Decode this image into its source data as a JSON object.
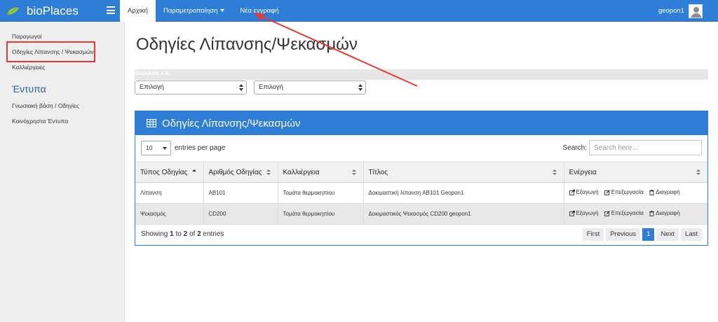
{
  "app": {
    "name": "bioPlaces"
  },
  "nav": {
    "tabs": [
      {
        "label": "Αρχική",
        "active": true
      },
      {
        "label": "Παραμετροποίηση",
        "dropdown": true
      },
      {
        "label": "Νέα εγγραφή"
      }
    ]
  },
  "user": {
    "name": "geopon1"
  },
  "sidebar": {
    "items": [
      {
        "label": "Παραγωγοί"
      },
      {
        "label": "Οδηγίες Λίπανσης / Ψεκασμών"
      },
      {
        "label": "Καλλιέργειες"
      }
    ],
    "section_title": "Έντυπα",
    "section_items": [
      {
        "label": "Γνωσιακή βάση / Οδηγίες"
      },
      {
        "label": "Κοινόχρηστα Έντυπα"
      }
    ]
  },
  "main": {
    "title": "Οδηγίες Λίπανσης/Ψεκασμών",
    "company_label": "DIANAME A.E.",
    "filters": [
      {
        "value": "Επιλογή"
      },
      {
        "value": "Επιλογή"
      }
    ],
    "panel": {
      "title": "Οδηγίες Λίπανσης/Ψεκασμών",
      "page_length": "10",
      "page_length_label": "entries per page",
      "search_label": "Search:",
      "search_placeholder": "Search here...",
      "columns": [
        "Τύπος Οδηγίας",
        "Αριθμός Οδηγίας",
        "Καλλιέργεια",
        "Τίτλος",
        "Ενέργεια"
      ],
      "rows": [
        {
          "type": "Λίπανση",
          "number": "AB101",
          "crop": "Τομάτα θερμοκηπίου",
          "title": "Δοκιμαστική λίπανση AB101 Geopon1"
        },
        {
          "type": "Ψεκασμός",
          "number": "CD200",
          "crop": "Τομάτα θερμοκηπίου",
          "title": "Δοκιμαστικός Ψεκασμός CD200 geopon1"
        }
      ],
      "actions": {
        "export": "Εξαγωγή",
        "edit": "Επεξεργασία",
        "delete": "Διαγραφή"
      },
      "info": {
        "prefix": "Showing",
        "from": "1",
        "to_word": "to",
        "to": "2",
        "of_word": "of",
        "total": "2",
        "suffix": "entries"
      },
      "pager": {
        "first": "First",
        "previous": "Previous",
        "current": "1",
        "next": "Next",
        "last": "Last"
      }
    }
  },
  "colors": {
    "primary": "#2e7dd6",
    "annotation": "#e53935",
    "sidebar_bg": "#eeeeee"
  },
  "icons": [
    "leaf-icon",
    "hamburger-icon",
    "caret-down-icon",
    "avatar",
    "table-icon",
    "sort-icon",
    "export-icon",
    "edit-icon",
    "trash-icon"
  ]
}
